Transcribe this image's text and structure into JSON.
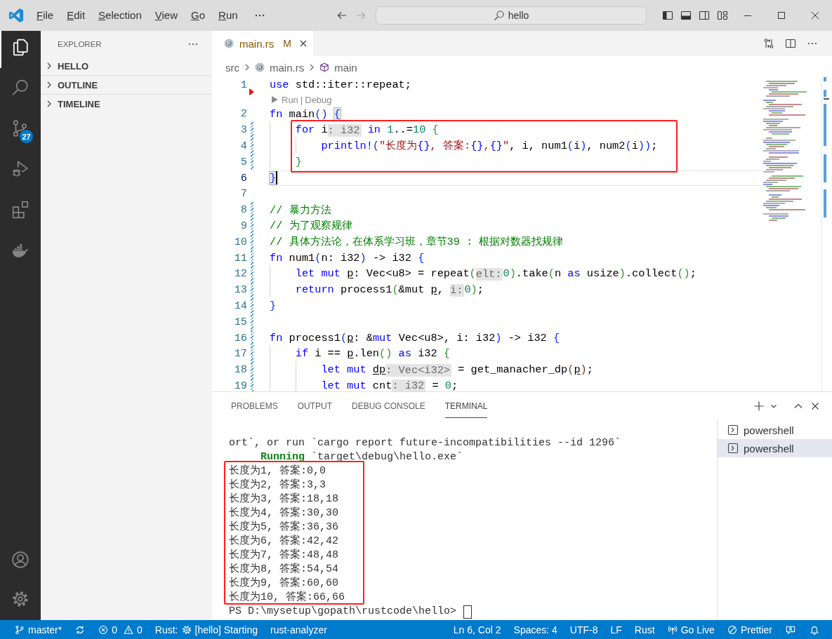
{
  "title_bar": {
    "menu": [
      {
        "label": "File"
      },
      {
        "label": "Edit"
      },
      {
        "label": "Selection"
      },
      {
        "label": "View"
      },
      {
        "label": "Go"
      },
      {
        "label": "Run"
      }
    ],
    "navigation": [
      {
        "kind": "back",
        "disabled": false
      },
      {
        "kind": "forward",
        "disabled": true
      }
    ],
    "command_center": {
      "label": "hello"
    },
    "layout_controls": [
      {
        "kind": "primary_sidebar",
        "on": true
      },
      {
        "kind": "panel",
        "on": true
      },
      {
        "kind": "secondary_sidebar",
        "on": false
      },
      {
        "kind": "customize_layout"
      }
    ]
  },
  "activity_bar": {
    "items": [
      {
        "kind": "explorer",
        "selected": true
      },
      {
        "kind": "search",
        "selected": false
      },
      {
        "kind": "source_control",
        "selected": false,
        "badge": "27"
      },
      {
        "kind": "run_debug",
        "selected": false
      },
      {
        "kind": "extensions",
        "selected": false
      },
      {
        "kind": "docker",
        "selected": false
      }
    ],
    "bottom": [
      {
        "kind": "accounts"
      },
      {
        "kind": "manage"
      }
    ]
  },
  "sidebar": {
    "title": "EXPLORER",
    "sections": [
      {
        "label": "HELLO",
        "expanded": false
      },
      {
        "label": "OUTLINE",
        "expanded": false
      },
      {
        "label": "TIMELINE",
        "expanded": false
      }
    ]
  },
  "editor": {
    "tabs": [
      {
        "label": "main.rs",
        "git_status": "M",
        "selected": true
      }
    ],
    "breadcrumbs": [
      {
        "label": "src",
        "kind": "folder"
      },
      {
        "label": "main.rs",
        "kind": "file"
      },
      {
        "label": "main",
        "kind": "symbol"
      }
    ],
    "blocks": [
      {
        "lines": [
          {
            "number": "1",
            "deleted": true,
            "segments": [
              {
                "text": "use",
                "kind": "keyword"
              },
              {
                "text": " std::iter::repeat;",
                "kind": "plain"
              }
            ]
          },
          {
            "number": "2",
            "codelens": {
              "items": [
                "Run",
                "Debug"
              ],
              "separator": "|"
            },
            "segments": [
              {
                "text": "fn",
                "kind": "keyword"
              },
              {
                "text": " main",
                "kind": "plain"
              },
              {
                "text": "() ",
                "kind": "bracket1"
              },
              {
                "text": "{",
                "kind": "bracket_match"
              }
            ]
          }
        ]
      },
      {
        "framed": true,
        "lines": [
          {
            "number": "3",
            "modified": true,
            "segments": [
              {
                "text": "    for",
                "kind": "keyword"
              },
              {
                "text": " i",
                "kind": "plain"
              },
              {
                "text": ": i32",
                "kind": "hint"
              },
              {
                "text": " in",
                "kind": "keyword"
              },
              {
                "text": " 1",
                "kind": "number"
              },
              {
                "text": "..=",
                "kind": "plain"
              },
              {
                "text": "10",
                "kind": "number"
              },
              {
                "text": " {",
                "kind": "bracket2"
              }
            ]
          },
          {
            "number": "4",
            "modified": true,
            "segments": [
              {
                "text": "        println!",
                "kind": "keyword"
              },
              {
                "text": "(",
                "kind": "bracket1"
              },
              {
                "text": "\"长度为",
                "kind": "string"
              },
              {
                "text": "{}",
                "kind": "format"
              },
              {
                "text": ", 答案:",
                "kind": "string"
              },
              {
                "text": "{}",
                "kind": "format"
              },
              {
                "text": ",",
                "kind": "string"
              },
              {
                "text": "{}",
                "kind": "format"
              },
              {
                "text": "\"",
                "kind": "string"
              },
              {
                "text": ", i, num1",
                "kind": "plain"
              },
              {
                "text": "(",
                "kind": "bracket1"
              },
              {
                "text": "i",
                "kind": "plain"
              },
              {
                "text": ")",
                "kind": "bracket1"
              },
              {
                "text": ", num2",
                "kind": "plain"
              },
              {
                "text": "(",
                "kind": "bracket1"
              },
              {
                "text": "i",
                "kind": "plain"
              },
              {
                "text": "))",
                "kind": "bracket1"
              },
              {
                "text": ";",
                "kind": "plain"
              }
            ]
          },
          {
            "number": "5",
            "modified": true,
            "segments": [
              {
                "text": "    }",
                "kind": "bracket2"
              }
            ]
          }
        ]
      },
      {
        "lines": [
          {
            "number": "6",
            "current": true,
            "segments": [
              {
                "text": "}",
                "kind": "bracket_match"
              }
            ]
          },
          {
            "number": "7"
          },
          {
            "number": "8",
            "modified": true,
            "segments": [
              {
                "text": "// 暴力方法",
                "kind": "comment"
              }
            ]
          },
          {
            "number": "9",
            "modified": true,
            "segments": [
              {
                "text": "// 为了观察规律",
                "kind": "comment"
              }
            ]
          },
          {
            "number": "10",
            "modified": true,
            "segments": [
              {
                "text": "// 具体方法论，在体系学习班，章节39 : 根据对数器找规律",
                "kind": "comment"
              }
            ]
          },
          {
            "number": "11",
            "modified": true,
            "segments": [
              {
                "text": "fn",
                "kind": "keyword"
              },
              {
                "text": " num1",
                "kind": "plain"
              },
              {
                "text": "(",
                "kind": "bracket1"
              },
              {
                "text": "n: i32",
                "kind": "plain"
              },
              {
                "text": ")",
                "kind": "bracket1"
              },
              {
                "text": " -> i32",
                "kind": "plain"
              },
              {
                "text": " {",
                "kind": "bracket1"
              }
            ]
          },
          {
            "number": "12",
            "modified": true,
            "segments": [
              {
                "text": "    let mut ",
                "kind": "keyword"
              },
              {
                "text": "p",
                "kind": "mutable"
              },
              {
                "text": ": Vec<u8> = repeat",
                "kind": "plain"
              },
              {
                "text": "(",
                "kind": "bracket2"
              },
              {
                "text": "elt:",
                "kind": "hint"
              },
              {
                "text": "0",
                "kind": "number"
              },
              {
                "text": ")",
                "kind": "bracket2"
              },
              {
                "text": ".take",
                "kind": "plain"
              },
              {
                "text": "(",
                "kind": "bracket2"
              },
              {
                "text": "n",
                "kind": "plain"
              },
              {
                "text": " as",
                "kind": "keyword"
              },
              {
                "text": " usize",
                "kind": "plain"
              },
              {
                "text": ")",
                "kind": "bracket2"
              },
              {
                "text": ".collect",
                "kind": "plain"
              },
              {
                "text": "()",
                "kind": "bracket2"
              },
              {
                "text": ";",
                "kind": "plain"
              }
            ]
          },
          {
            "number": "13",
            "modified": true,
            "segments": [
              {
                "text": "    return",
                "kind": "keyword"
              },
              {
                "text": " process1",
                "kind": "plain"
              },
              {
                "text": "(",
                "kind": "bracket2"
              },
              {
                "text": "&mut ",
                "kind": "plain"
              },
              {
                "text": "p",
                "kind": "mutable"
              },
              {
                "text": ", ",
                "kind": "plain"
              },
              {
                "text": "i:",
                "kind": "hint"
              },
              {
                "text": "0",
                "kind": "number"
              },
              {
                "text": ")",
                "kind": "bracket2"
              },
              {
                "text": ";",
                "kind": "plain"
              }
            ]
          },
          {
            "number": "14",
            "modified": true,
            "segments": [
              {
                "text": "}",
                "kind": "bracket1"
              }
            ]
          },
          {
            "number": "15",
            "modified": true
          },
          {
            "number": "16",
            "modified": true,
            "segments": [
              {
                "text": "fn",
                "kind": "keyword"
              },
              {
                "text": " process1",
                "kind": "plain"
              },
              {
                "text": "(",
                "kind": "bracket1"
              },
              {
                "text": "p",
                "kind": "mutable"
              },
              {
                "text": ": &",
                "kind": "plain"
              },
              {
                "text": "mut",
                "kind": "keyword"
              },
              {
                "text": " Vec<u8>, i: i32",
                "kind": "plain"
              },
              {
                "text": ")",
                "kind": "bracket1"
              },
              {
                "text": " -> i32",
                "kind": "plain"
              },
              {
                "text": " {",
                "kind": "bracket1"
              }
            ]
          },
          {
            "number": "17",
            "modified": true,
            "segments": [
              {
                "text": "    if",
                "kind": "keyword"
              },
              {
                "text": " i == ",
                "kind": "plain"
              },
              {
                "text": "p",
                "kind": "mutable"
              },
              {
                "text": ".len",
                "kind": "plain"
              },
              {
                "text": "()",
                "kind": "bracket2"
              },
              {
                "text": " as",
                "kind": "keyword"
              },
              {
                "text": " i32",
                "kind": "plain"
              },
              {
                "text": " {",
                "kind": "bracket2"
              }
            ]
          },
          {
            "number": "18",
            "modified": true,
            "segments": [
              {
                "text": "        let mut ",
                "kind": "keyword"
              },
              {
                "text": "dp",
                "kind": "mutable"
              },
              {
                "text": ": Vec<i32>",
                "kind": "hint"
              },
              {
                "text": " = get_manacher_dp",
                "kind": "plain"
              },
              {
                "text": "(",
                "kind": "bracket3"
              },
              {
                "text": "p",
                "kind": "mutable"
              },
              {
                "text": ")",
                "kind": "bracket3"
              },
              {
                "text": ";",
                "kind": "plain"
              }
            ]
          },
          {
            "number": "19",
            "modified": true,
            "segments": [
              {
                "text": "        let mut",
                "kind": "keyword"
              },
              {
                "text": " cnt",
                "kind": "plain"
              },
              {
                "text": ": i32",
                "kind": "hint"
              },
              {
                "text": " = ",
                "kind": "plain"
              },
              {
                "text": "0",
                "kind": "number"
              },
              {
                "text": ";",
                "kind": "plain"
              }
            ]
          }
        ]
      }
    ]
  },
  "panel": {
    "tabs": [
      {
        "label": "PROBLEMS",
        "selected": false
      },
      {
        "label": "OUTPUT",
        "selected": false
      },
      {
        "label": "DEBUG CONSOLE",
        "selected": false
      },
      {
        "label": "TERMINAL",
        "selected": true
      }
    ],
    "terminal": {
      "blocks": [
        {
          "lines": [
            {
              "segments": [
                {
                  "text": "ort`, or run `cargo report future-incompatibilities --id 1296`",
                  "kind": "plain"
                }
              ]
            },
            {
              "segments": [
                {
                  "text": "     Running",
                  "kind": "status"
                },
                {
                  "text": " `target\\debug\\hello.exe`",
                  "kind": "plain"
                }
              ]
            }
          ]
        },
        {
          "framed": true,
          "lines": [
            {
              "segments": [
                {
                  "text": "长度为1, 答案:0,0",
                  "kind": "plain"
                }
              ]
            },
            {
              "segments": [
                {
                  "text": "长度为2, 答案:3,3",
                  "kind": "plain"
                }
              ]
            },
            {
              "segments": [
                {
                  "text": "长度为3, 答案:18,18",
                  "kind": "plain"
                }
              ]
            },
            {
              "segments": [
                {
                  "text": "长度为4, 答案:30,30",
                  "kind": "plain"
                }
              ]
            },
            {
              "segments": [
                {
                  "text": "长度为5, 答案:36,36",
                  "kind": "plain"
                }
              ]
            },
            {
              "segments": [
                {
                  "text": "长度为6, 答案:42,42",
                  "kind": "plain"
                }
              ]
            },
            {
              "segments": [
                {
                  "text": "长度为7, 答案:48,48",
                  "kind": "plain"
                }
              ]
            },
            {
              "segments": [
                {
                  "text": "长度为8, 答案:54,54",
                  "kind": "plain"
                }
              ]
            },
            {
              "segments": [
                {
                  "text": "长度为9, 答案:60,60",
                  "kind": "plain"
                }
              ]
            },
            {
              "segments": [
                {
                  "text": "长度为10, 答案:66,66",
                  "kind": "plain"
                }
              ]
            }
          ]
        }
      ],
      "prompt": "PS D:\\mysetup\\gopath\\rustcode\\hello>"
    },
    "sessions": [
      {
        "label": "powershell",
        "selected": false
      },
      {
        "label": "powershell",
        "selected": true
      }
    ]
  },
  "status_bar": {
    "left": [
      {
        "kind": "branch",
        "label": "master*"
      },
      {
        "kind": "sync"
      },
      {
        "kind": "problems",
        "errors": "0",
        "warnings": "0"
      },
      {
        "kind": "language_server",
        "label": "Rust:",
        "detail": "[hello] Starting"
      },
      {
        "kind": "text",
        "label": "rust-analyzer"
      }
    ],
    "right": [
      {
        "kind": "text",
        "label": "Ln 6, Col 2"
      },
      {
        "kind": "text",
        "label": "Spaces: 4"
      },
      {
        "kind": "text",
        "label": "UTF-8"
      },
      {
        "kind": "text",
        "label": "LF"
      },
      {
        "kind": "text",
        "label": "Rust"
      },
      {
        "kind": "go_live",
        "label": "Go Live"
      },
      {
        "kind": "prettier",
        "label": "Prettier"
      },
      {
        "kind": "feedback"
      },
      {
        "kind": "notifications"
      }
    ]
  }
}
